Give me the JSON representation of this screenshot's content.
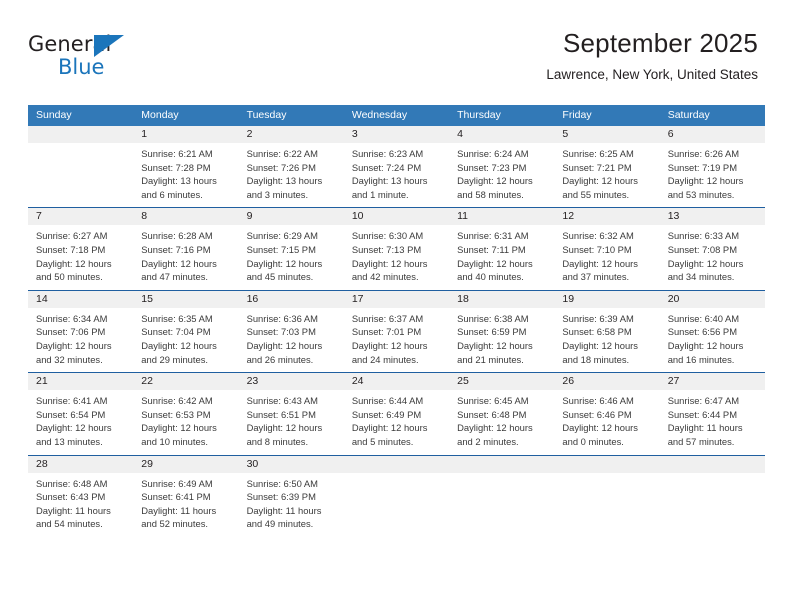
{
  "logo": {
    "word_general": "General",
    "word_blue": "Blue",
    "triangle_icon": "triangle-icon"
  },
  "header": {
    "month_title": "September 2025",
    "location": "Lawrence, New York, United States"
  },
  "colors": {
    "header_blue": "#3279b7",
    "row_divider_blue": "#1f5fa0",
    "daynum_band": "#f0f0f0",
    "brand_blue": "#1b75bb",
    "text": "#231f20"
  },
  "calendar": {
    "weekday_headers": [
      "Sunday",
      "Monday",
      "Tuesday",
      "Wednesday",
      "Thursday",
      "Friday",
      "Saturday"
    ],
    "weeks": [
      [
        {
          "day": "",
          "sunrise": "",
          "sunset": "",
          "daylight_1": "",
          "daylight_2": ""
        },
        {
          "day": "1",
          "sunrise": "Sunrise: 6:21 AM",
          "sunset": "Sunset: 7:28 PM",
          "daylight_1": "Daylight: 13 hours",
          "daylight_2": "and 6 minutes."
        },
        {
          "day": "2",
          "sunrise": "Sunrise: 6:22 AM",
          "sunset": "Sunset: 7:26 PM",
          "daylight_1": "Daylight: 13 hours",
          "daylight_2": "and 3 minutes."
        },
        {
          "day": "3",
          "sunrise": "Sunrise: 6:23 AM",
          "sunset": "Sunset: 7:24 PM",
          "daylight_1": "Daylight: 13 hours",
          "daylight_2": "and 1 minute."
        },
        {
          "day": "4",
          "sunrise": "Sunrise: 6:24 AM",
          "sunset": "Sunset: 7:23 PM",
          "daylight_1": "Daylight: 12 hours",
          "daylight_2": "and 58 minutes."
        },
        {
          "day": "5",
          "sunrise": "Sunrise: 6:25 AM",
          "sunset": "Sunset: 7:21 PM",
          "daylight_1": "Daylight: 12 hours",
          "daylight_2": "and 55 minutes."
        },
        {
          "day": "6",
          "sunrise": "Sunrise: 6:26 AM",
          "sunset": "Sunset: 7:19 PM",
          "daylight_1": "Daylight: 12 hours",
          "daylight_2": "and 53 minutes."
        }
      ],
      [
        {
          "day": "7",
          "sunrise": "Sunrise: 6:27 AM",
          "sunset": "Sunset: 7:18 PM",
          "daylight_1": "Daylight: 12 hours",
          "daylight_2": "and 50 minutes."
        },
        {
          "day": "8",
          "sunrise": "Sunrise: 6:28 AM",
          "sunset": "Sunset: 7:16 PM",
          "daylight_1": "Daylight: 12 hours",
          "daylight_2": "and 47 minutes."
        },
        {
          "day": "9",
          "sunrise": "Sunrise: 6:29 AM",
          "sunset": "Sunset: 7:15 PM",
          "daylight_1": "Daylight: 12 hours",
          "daylight_2": "and 45 minutes."
        },
        {
          "day": "10",
          "sunrise": "Sunrise: 6:30 AM",
          "sunset": "Sunset: 7:13 PM",
          "daylight_1": "Daylight: 12 hours",
          "daylight_2": "and 42 minutes."
        },
        {
          "day": "11",
          "sunrise": "Sunrise: 6:31 AM",
          "sunset": "Sunset: 7:11 PM",
          "daylight_1": "Daylight: 12 hours",
          "daylight_2": "and 40 minutes."
        },
        {
          "day": "12",
          "sunrise": "Sunrise: 6:32 AM",
          "sunset": "Sunset: 7:10 PM",
          "daylight_1": "Daylight: 12 hours",
          "daylight_2": "and 37 minutes."
        },
        {
          "day": "13",
          "sunrise": "Sunrise: 6:33 AM",
          "sunset": "Sunset: 7:08 PM",
          "daylight_1": "Daylight: 12 hours",
          "daylight_2": "and 34 minutes."
        }
      ],
      [
        {
          "day": "14",
          "sunrise": "Sunrise: 6:34 AM",
          "sunset": "Sunset: 7:06 PM",
          "daylight_1": "Daylight: 12 hours",
          "daylight_2": "and 32 minutes."
        },
        {
          "day": "15",
          "sunrise": "Sunrise: 6:35 AM",
          "sunset": "Sunset: 7:04 PM",
          "daylight_1": "Daylight: 12 hours",
          "daylight_2": "and 29 minutes."
        },
        {
          "day": "16",
          "sunrise": "Sunrise: 6:36 AM",
          "sunset": "Sunset: 7:03 PM",
          "daylight_1": "Daylight: 12 hours",
          "daylight_2": "and 26 minutes."
        },
        {
          "day": "17",
          "sunrise": "Sunrise: 6:37 AM",
          "sunset": "Sunset: 7:01 PM",
          "daylight_1": "Daylight: 12 hours",
          "daylight_2": "and 24 minutes."
        },
        {
          "day": "18",
          "sunrise": "Sunrise: 6:38 AM",
          "sunset": "Sunset: 6:59 PM",
          "daylight_1": "Daylight: 12 hours",
          "daylight_2": "and 21 minutes."
        },
        {
          "day": "19",
          "sunrise": "Sunrise: 6:39 AM",
          "sunset": "Sunset: 6:58 PM",
          "daylight_1": "Daylight: 12 hours",
          "daylight_2": "and 18 minutes."
        },
        {
          "day": "20",
          "sunrise": "Sunrise: 6:40 AM",
          "sunset": "Sunset: 6:56 PM",
          "daylight_1": "Daylight: 12 hours",
          "daylight_2": "and 16 minutes."
        }
      ],
      [
        {
          "day": "21",
          "sunrise": "Sunrise: 6:41 AM",
          "sunset": "Sunset: 6:54 PM",
          "daylight_1": "Daylight: 12 hours",
          "daylight_2": "and 13 minutes."
        },
        {
          "day": "22",
          "sunrise": "Sunrise: 6:42 AM",
          "sunset": "Sunset: 6:53 PM",
          "daylight_1": "Daylight: 12 hours",
          "daylight_2": "and 10 minutes."
        },
        {
          "day": "23",
          "sunrise": "Sunrise: 6:43 AM",
          "sunset": "Sunset: 6:51 PM",
          "daylight_1": "Daylight: 12 hours",
          "daylight_2": "and 8 minutes."
        },
        {
          "day": "24",
          "sunrise": "Sunrise: 6:44 AM",
          "sunset": "Sunset: 6:49 PM",
          "daylight_1": "Daylight: 12 hours",
          "daylight_2": "and 5 minutes."
        },
        {
          "day": "25",
          "sunrise": "Sunrise: 6:45 AM",
          "sunset": "Sunset: 6:48 PM",
          "daylight_1": "Daylight: 12 hours",
          "daylight_2": "and 2 minutes."
        },
        {
          "day": "26",
          "sunrise": "Sunrise: 6:46 AM",
          "sunset": "Sunset: 6:46 PM",
          "daylight_1": "Daylight: 12 hours",
          "daylight_2": "and 0 minutes."
        },
        {
          "day": "27",
          "sunrise": "Sunrise: 6:47 AM",
          "sunset": "Sunset: 6:44 PM",
          "daylight_1": "Daylight: 11 hours",
          "daylight_2": "and 57 minutes."
        }
      ],
      [
        {
          "day": "28",
          "sunrise": "Sunrise: 6:48 AM",
          "sunset": "Sunset: 6:43 PM",
          "daylight_1": "Daylight: 11 hours",
          "daylight_2": "and 54 minutes."
        },
        {
          "day": "29",
          "sunrise": "Sunrise: 6:49 AM",
          "sunset": "Sunset: 6:41 PM",
          "daylight_1": "Daylight: 11 hours",
          "daylight_2": "and 52 minutes."
        },
        {
          "day": "30",
          "sunrise": "Sunrise: 6:50 AM",
          "sunset": "Sunset: 6:39 PM",
          "daylight_1": "Daylight: 11 hours",
          "daylight_2": "and 49 minutes."
        },
        {
          "day": "",
          "sunrise": "",
          "sunset": "",
          "daylight_1": "",
          "daylight_2": ""
        },
        {
          "day": "",
          "sunrise": "",
          "sunset": "",
          "daylight_1": "",
          "daylight_2": ""
        },
        {
          "day": "",
          "sunrise": "",
          "sunset": "",
          "daylight_1": "",
          "daylight_2": ""
        },
        {
          "day": "",
          "sunrise": "",
          "sunset": "",
          "daylight_1": "",
          "daylight_2": ""
        }
      ]
    ]
  }
}
